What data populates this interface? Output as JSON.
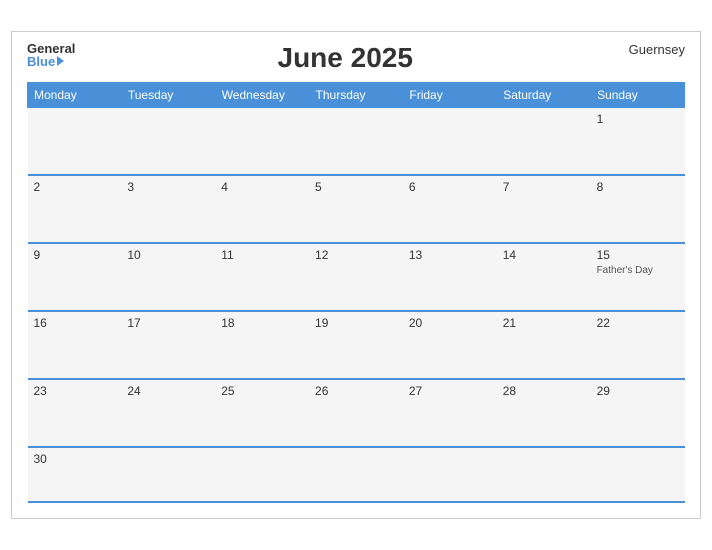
{
  "header": {
    "logo_general": "General",
    "logo_blue": "Blue",
    "title": "June 2025",
    "region": "Guernsey"
  },
  "weekdays": [
    "Monday",
    "Tuesday",
    "Wednesday",
    "Thursday",
    "Friday",
    "Saturday",
    "Sunday"
  ],
  "weeks": [
    [
      {
        "day": "",
        "event": ""
      },
      {
        "day": "",
        "event": ""
      },
      {
        "day": "",
        "event": ""
      },
      {
        "day": "",
        "event": ""
      },
      {
        "day": "",
        "event": ""
      },
      {
        "day": "",
        "event": ""
      },
      {
        "day": "1",
        "event": ""
      }
    ],
    [
      {
        "day": "2",
        "event": ""
      },
      {
        "day": "3",
        "event": ""
      },
      {
        "day": "4",
        "event": ""
      },
      {
        "day": "5",
        "event": ""
      },
      {
        "day": "6",
        "event": ""
      },
      {
        "day": "7",
        "event": ""
      },
      {
        "day": "8",
        "event": ""
      }
    ],
    [
      {
        "day": "9",
        "event": ""
      },
      {
        "day": "10",
        "event": ""
      },
      {
        "day": "11",
        "event": ""
      },
      {
        "day": "12",
        "event": ""
      },
      {
        "day": "13",
        "event": ""
      },
      {
        "day": "14",
        "event": ""
      },
      {
        "day": "15",
        "event": "Father's Day"
      }
    ],
    [
      {
        "day": "16",
        "event": ""
      },
      {
        "day": "17",
        "event": ""
      },
      {
        "day": "18",
        "event": ""
      },
      {
        "day": "19",
        "event": ""
      },
      {
        "day": "20",
        "event": ""
      },
      {
        "day": "21",
        "event": ""
      },
      {
        "day": "22",
        "event": ""
      }
    ],
    [
      {
        "day": "23",
        "event": ""
      },
      {
        "day": "24",
        "event": ""
      },
      {
        "day": "25",
        "event": ""
      },
      {
        "day": "26",
        "event": ""
      },
      {
        "day": "27",
        "event": ""
      },
      {
        "day": "28",
        "event": ""
      },
      {
        "day": "29",
        "event": ""
      }
    ],
    [
      {
        "day": "30",
        "event": ""
      },
      {
        "day": "",
        "event": ""
      },
      {
        "day": "",
        "event": ""
      },
      {
        "day": "",
        "event": ""
      },
      {
        "day": "",
        "event": ""
      },
      {
        "day": "",
        "event": ""
      },
      {
        "day": "",
        "event": ""
      }
    ]
  ]
}
